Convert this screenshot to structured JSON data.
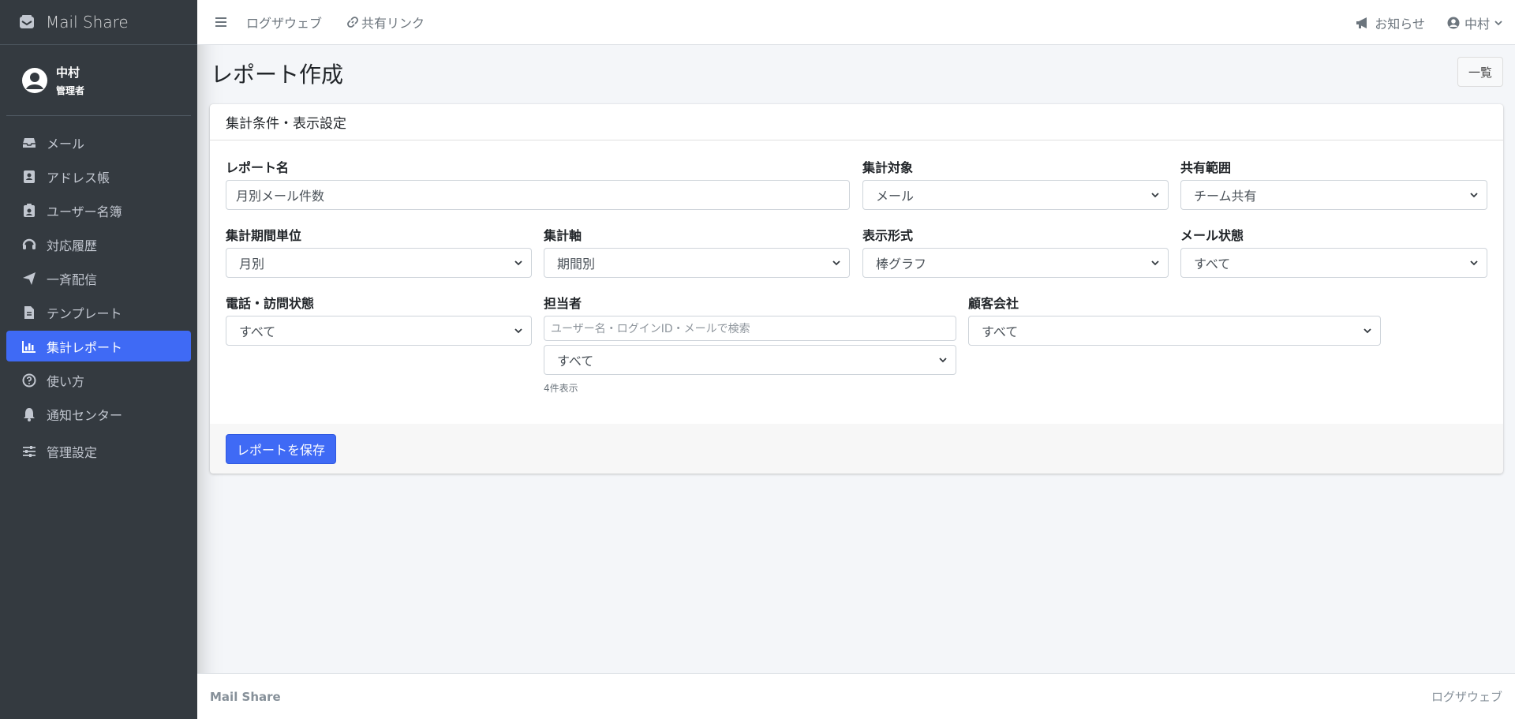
{
  "app": {
    "brand": "Mail Share"
  },
  "user": {
    "name": "中村",
    "role": "管理者"
  },
  "sidebar": {
    "items": [
      {
        "label": "メール",
        "icon": "inbox-icon"
      },
      {
        "label": "アドレス帳",
        "icon": "address-book-icon"
      },
      {
        "label": "ユーザー名簿",
        "icon": "id-badge-icon"
      },
      {
        "label": "対応履歴",
        "icon": "headset-icon"
      },
      {
        "label": "一斉配信",
        "icon": "paper-plane-icon"
      },
      {
        "label": "テンプレート",
        "icon": "file-text-icon"
      },
      {
        "label": "集計レポート",
        "icon": "bar-chart-icon",
        "active": true
      },
      {
        "label": "使い方",
        "icon": "question-circle-icon"
      },
      {
        "label": "通知センター",
        "icon": "bell-icon"
      },
      {
        "label": "管理設定",
        "icon": "sliders-icon"
      }
    ]
  },
  "topbar": {
    "links": [
      {
        "label": "ログザウェブ"
      },
      {
        "label": "共有リンク",
        "icon": "link-icon"
      }
    ],
    "notice": "お知らせ",
    "user_menu": "中村"
  },
  "page": {
    "title": "レポート作成",
    "list_button": "一覧"
  },
  "card": {
    "header": "集計条件・表示設定",
    "fields": {
      "report_name": {
        "label": "レポート名",
        "value": "月別メール件数"
      },
      "target": {
        "label": "集計対象",
        "value": "メール"
      },
      "share_scope": {
        "label": "共有範囲",
        "value": "チーム共有"
      },
      "period_unit": {
        "label": "集計期間単位",
        "value": "月別"
      },
      "axis": {
        "label": "集計軸",
        "value": "期間別"
      },
      "display_format": {
        "label": "表示形式",
        "value": "棒グラフ"
      },
      "mail_status": {
        "label": "メール状態",
        "value": "すべて"
      },
      "call_visit_status": {
        "label": "電話・訪問状態",
        "value": "すべて"
      },
      "assignee": {
        "label": "担当者",
        "search_placeholder": "ユーザー名・ログインID・メールで検索",
        "value": "すべて",
        "hint": "4件表示"
      },
      "customer_company": {
        "label": "顧客会社",
        "value": "すべて"
      }
    },
    "save_button": "レポートを保存"
  },
  "footer": {
    "left": "Mail Share",
    "right": "ログザウェブ"
  },
  "colors": {
    "sidebar_bg": "#343a40",
    "accent": "#3f6af5",
    "content_bg": "#f4f6f9"
  }
}
